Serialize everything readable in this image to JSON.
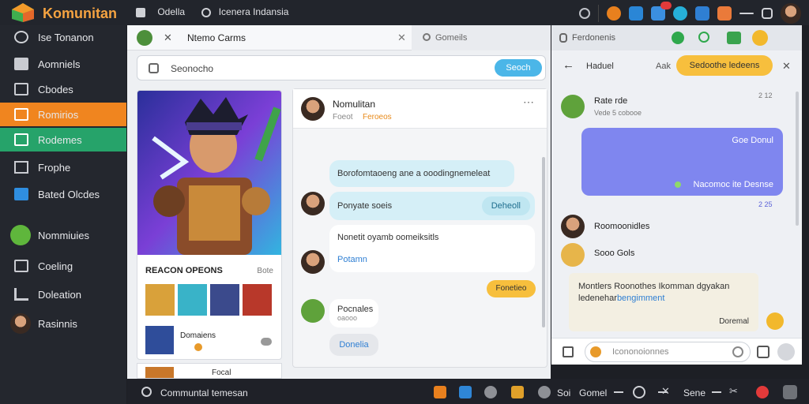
{
  "top": {
    "brand": "Komunitan",
    "nav1": "Odella",
    "nav2": "Icenera Indansia"
  },
  "sidebar": {
    "header": "Ise Tonanon",
    "items": [
      {
        "label": "Aomniels"
      },
      {
        "label": "Cbodes"
      },
      {
        "label": "Romirios",
        "state": "active"
      },
      {
        "label": "Rodemes",
        "state": "green"
      },
      {
        "label": "Frophe"
      },
      {
        "label": "Bated Olcdes"
      },
      {
        "label": "Nommiuies"
      },
      {
        "label": "Coeling"
      },
      {
        "label": "Doleation"
      },
      {
        "label": "Rasinnis"
      }
    ]
  },
  "main": {
    "tab1": "Ntemo Carms",
    "tab2": "Gomeils",
    "search_placeholder": "Seonocho",
    "search_button": "Seoch",
    "card_title": "REACON OPEONS",
    "card_more": "Bote",
    "card_item": "Domaiens",
    "card_sub": "Focal"
  },
  "chat": {
    "name": "Nomulitan",
    "sub_a": "Foeot",
    "sub_b": "Feroeos",
    "msg1": "Borofomtaoeng ane a ooodingnemeleat",
    "msg2": "Ponyate soeis",
    "msg2_tag": "Deheoll",
    "msg3": "Nonetit oyamb oomeiksitls",
    "msg3_link": "Potamn",
    "msg4_tag": "Fonetieo",
    "msg5": "Pocnales",
    "msg5_sub": "oaooo",
    "msg6": "Donelia"
  },
  "right": {
    "search": "Ferdonenis",
    "back_label": "Haduel",
    "ask": "Aak",
    "pill": "Sedoothe ledeens",
    "user": "Rate rde",
    "user_sub": "Vede 5 cobooe",
    "time1": "2 12",
    "msg_top": "Goe Donul",
    "msg_bottom": "Nacomoc ite Desnse",
    "time2": "2 25",
    "row1": "Roomoonidles",
    "row2": "Sooo Gols",
    "note": "Montlers Roonothes Ikomman dgyakan ledenehar",
    "note_link": "bengimment",
    "note_right": "Doremal",
    "input": "Icononoionnes"
  },
  "bottom": {
    "label": "Communtal temesan",
    "items": [
      "Soi",
      "Gomel",
      "Sene"
    ]
  },
  "colors": {
    "accent_orange": "#f0851f",
    "accent_green": "#26a36a",
    "accent_blue": "#4bb6e8",
    "bubble_purple": "#7f86ef",
    "pill_yellow": "#f7bf3d"
  }
}
